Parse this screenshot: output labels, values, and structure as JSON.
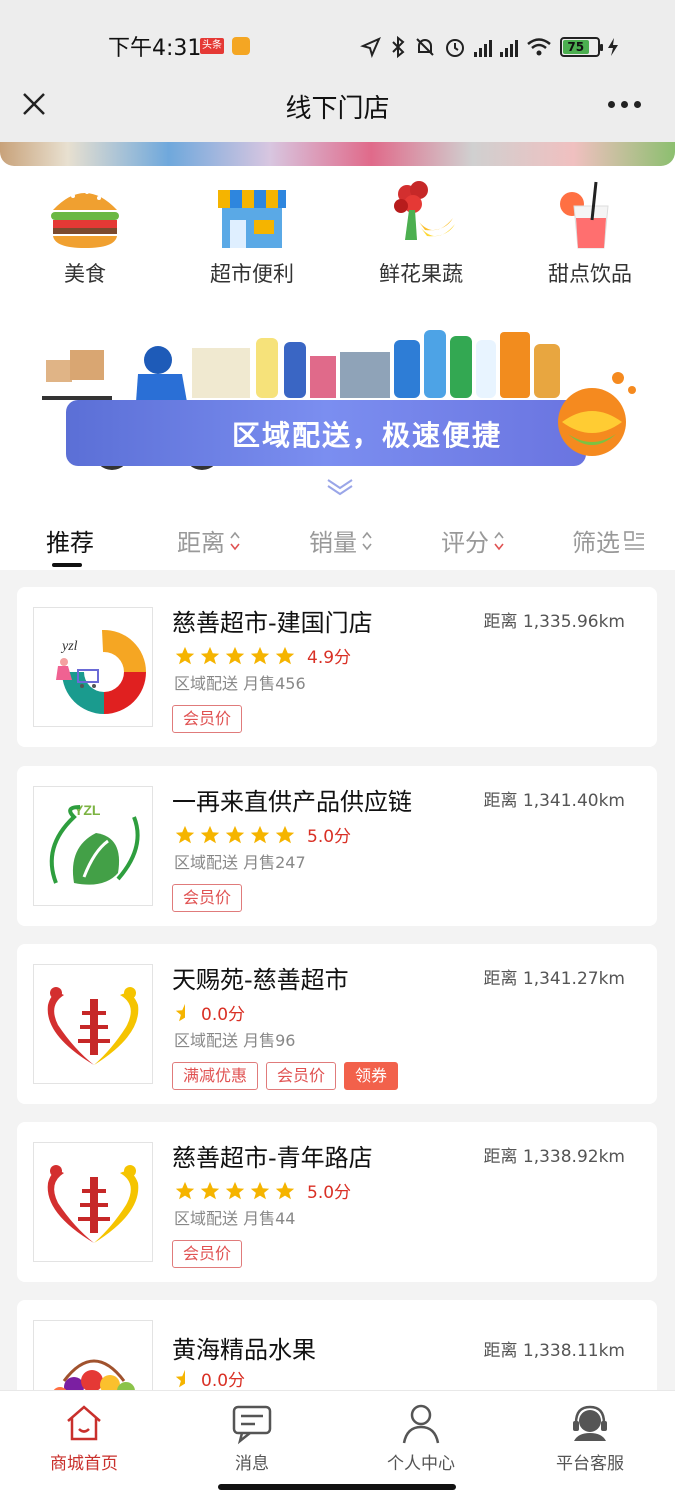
{
  "status_bar": {
    "time": "下午4:31",
    "badge": "头条",
    "battery": "75"
  },
  "nav": {
    "title": "线下门店"
  },
  "categories": [
    {
      "label": "美食",
      "icon": "burger-icon"
    },
    {
      "label": "超市便利",
      "icon": "store-icon"
    },
    {
      "label": "鲜花果蔬",
      "icon": "flower-fruit-icon"
    },
    {
      "label": "甜点饮品",
      "icon": "drink-icon"
    }
  ],
  "promo": {
    "text": "区域配送，极速便捷"
  },
  "filter_tabs": [
    {
      "label": "推荐",
      "active": true
    },
    {
      "label": "距离"
    },
    {
      "label": "销量"
    },
    {
      "label": "评分"
    },
    {
      "label": "筛选"
    }
  ],
  "stores": [
    {
      "name": "慈善超市-建国门店",
      "distance": "距离 1,335.96km",
      "stars": 5,
      "score": "4.9分",
      "sales": "区域配送 月售456",
      "tags": [
        "会员价"
      ]
    },
    {
      "name": "一再来直供产品供应链",
      "distance": "距离 1,341.40km",
      "stars": 5,
      "score": "5.0分",
      "sales": "区域配送 月售247",
      "tags": [
        "会员价"
      ]
    },
    {
      "name": "天赐苑-慈善超市",
      "distance": "距离 1,341.27km",
      "stars": 0.5,
      "score": "0.0分",
      "sales": "区域配送 月售96",
      "tags": [
        "满减优惠",
        "会员价"
      ],
      "coupon": "领券"
    },
    {
      "name": "慈善超市-青年路店",
      "distance": "距离 1,338.92km",
      "stars": 5,
      "score": "5.0分",
      "sales": "区域配送 月售44",
      "tags": [
        "会员价"
      ]
    },
    {
      "name": "黄海精品水果",
      "distance": "距离 1,338.11km",
      "stars": 0.5,
      "score": "0.0分"
    }
  ],
  "logos": {
    "ysl_text": "yzl",
    "ycl_text": "YZL"
  },
  "tabbar": [
    {
      "label": "商城首页",
      "active": true
    },
    {
      "label": "消息"
    },
    {
      "label": "个人中心"
    },
    {
      "label": "平台客服"
    }
  ],
  "colors": {
    "accent": "#c9302c",
    "star": "#f5b400",
    "tag_border": "#e07b7b",
    "coupon": "#f2614b"
  }
}
